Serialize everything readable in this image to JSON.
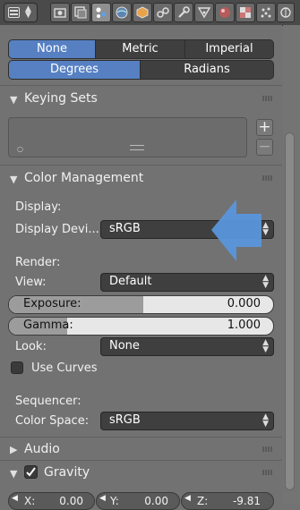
{
  "units": {
    "system_options": [
      "None",
      "Metric",
      "Imperial"
    ],
    "selected_system": "None",
    "rotation_options": [
      "Degrees",
      "Radians"
    ],
    "selected_rotation": "Degrees"
  },
  "keying_sets": {
    "title": "Keying Sets",
    "add_label": "+",
    "remove_label": "−"
  },
  "color_management": {
    "title": "Color Management",
    "display_section": "Display:",
    "display_device_label": "Display Devi...",
    "display_device_value": "sRGB",
    "render_section": "Render:",
    "view_label": "View:",
    "view_value": "Default",
    "exposure_label": "Exposure:",
    "exposure_value": "0.000",
    "gamma_label": "Gamma:",
    "gamma_value": "1.000",
    "look_label": "Look:",
    "look_value": "None",
    "use_curves_label": "Use Curves",
    "sequencer_section": "Sequencer:",
    "color_space_label": "Color Space:",
    "color_space_value": "sRGB",
    "exposure_fill": 0.51,
    "gamma_fill": 0.22
  },
  "audio": {
    "title": "Audio"
  },
  "gravity": {
    "title": "Gravity",
    "enabled": true,
    "x_label": "X:",
    "x_value": "0.00",
    "y_label": "Y:",
    "y_value": "0.00",
    "z_label": "Z:",
    "z_value": "-9.81"
  },
  "colors": {
    "accent": "#5680c2",
    "arrow": "#5a95dc"
  }
}
